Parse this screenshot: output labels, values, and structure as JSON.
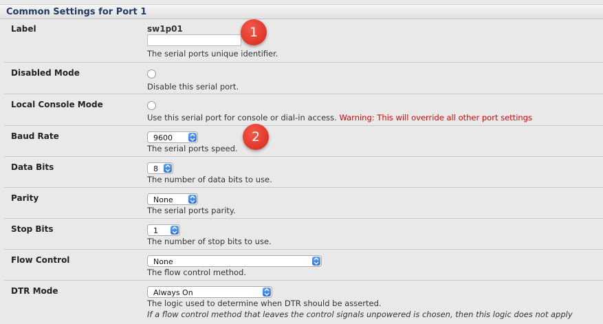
{
  "section_title": "Common Settings for Port 1",
  "label": {
    "label": "Label",
    "value": "sw1p01",
    "input_value": "",
    "description": "The serial ports unique identifier."
  },
  "disabled_mode": {
    "label": "Disabled Mode",
    "description": "Disable this serial port.",
    "checked": false
  },
  "local_console_mode": {
    "label": "Local Console Mode",
    "description": "Use this serial port for console or dial-in access.",
    "warning": "Warning: This will override all other port settings",
    "checked": false
  },
  "baud_rate": {
    "label": "Baud Rate",
    "selected": "9600",
    "description": "The serial ports speed."
  },
  "data_bits": {
    "label": "Data Bits",
    "selected": "8",
    "description": "The number of data bits to use."
  },
  "parity": {
    "label": "Parity",
    "selected": "None",
    "description": "The serial ports parity."
  },
  "stop_bits": {
    "label": "Stop Bits",
    "selected": "1",
    "description": "The number of stop bits to use."
  },
  "flow_control": {
    "label": "Flow Control",
    "selected": "None",
    "description": "The flow control method."
  },
  "dtr_mode": {
    "label": "DTR Mode",
    "selected": "Always On",
    "description": "The logic used to determine when DTR should be asserted.",
    "note": "If a flow control method that leaves the control signals unpowered is chosen, then this logic does not apply"
  },
  "badges": {
    "first": "1",
    "second": "2"
  },
  "colors": {
    "title": "#1f3a66",
    "warning": "#e00000",
    "badge": "#d8261a",
    "select_arrow": "#2f72e0"
  }
}
